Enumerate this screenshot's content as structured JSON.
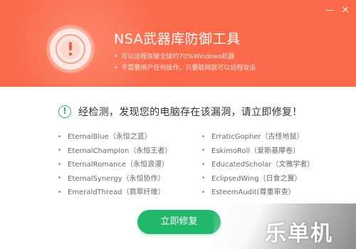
{
  "header": {
    "title": "NSA武器库防御工具",
    "bullets": [
      "可以远程攻破全球约70%Windows机器",
      "不需要用户任何操作，只要联网就可以远程攻击"
    ],
    "background_color": "#fb6a4a"
  },
  "window_controls": {
    "minimize": "—",
    "close": "✕"
  },
  "alert": {
    "icon": "exclamation-circle-icon",
    "text": "经检测，发现您的电脑存在该漏洞，请立即修复！",
    "icon_color": "#2fb36f"
  },
  "vulnerabilities": {
    "left": [
      "EternalBlue（永恒之蓝）",
      "EternalChampion（永恒王者）",
      "EternalRomance（永恒浪漫）",
      "EternalSynergy（永恒协作）",
      "EmeraldThread（翡翠纤维）"
    ],
    "right": [
      "ErraticGopher（古怪地鼠）",
      "EskimoRoll（爱斯基摩卷）",
      "EducatedScholar（文雅学者）",
      "EclipsedWing（日食之翼）",
      "EsteemAudit(尊重审查）"
    ]
  },
  "fix_button": {
    "label": "立即修复",
    "color": "#22b86c"
  },
  "watermark": "乐单机"
}
